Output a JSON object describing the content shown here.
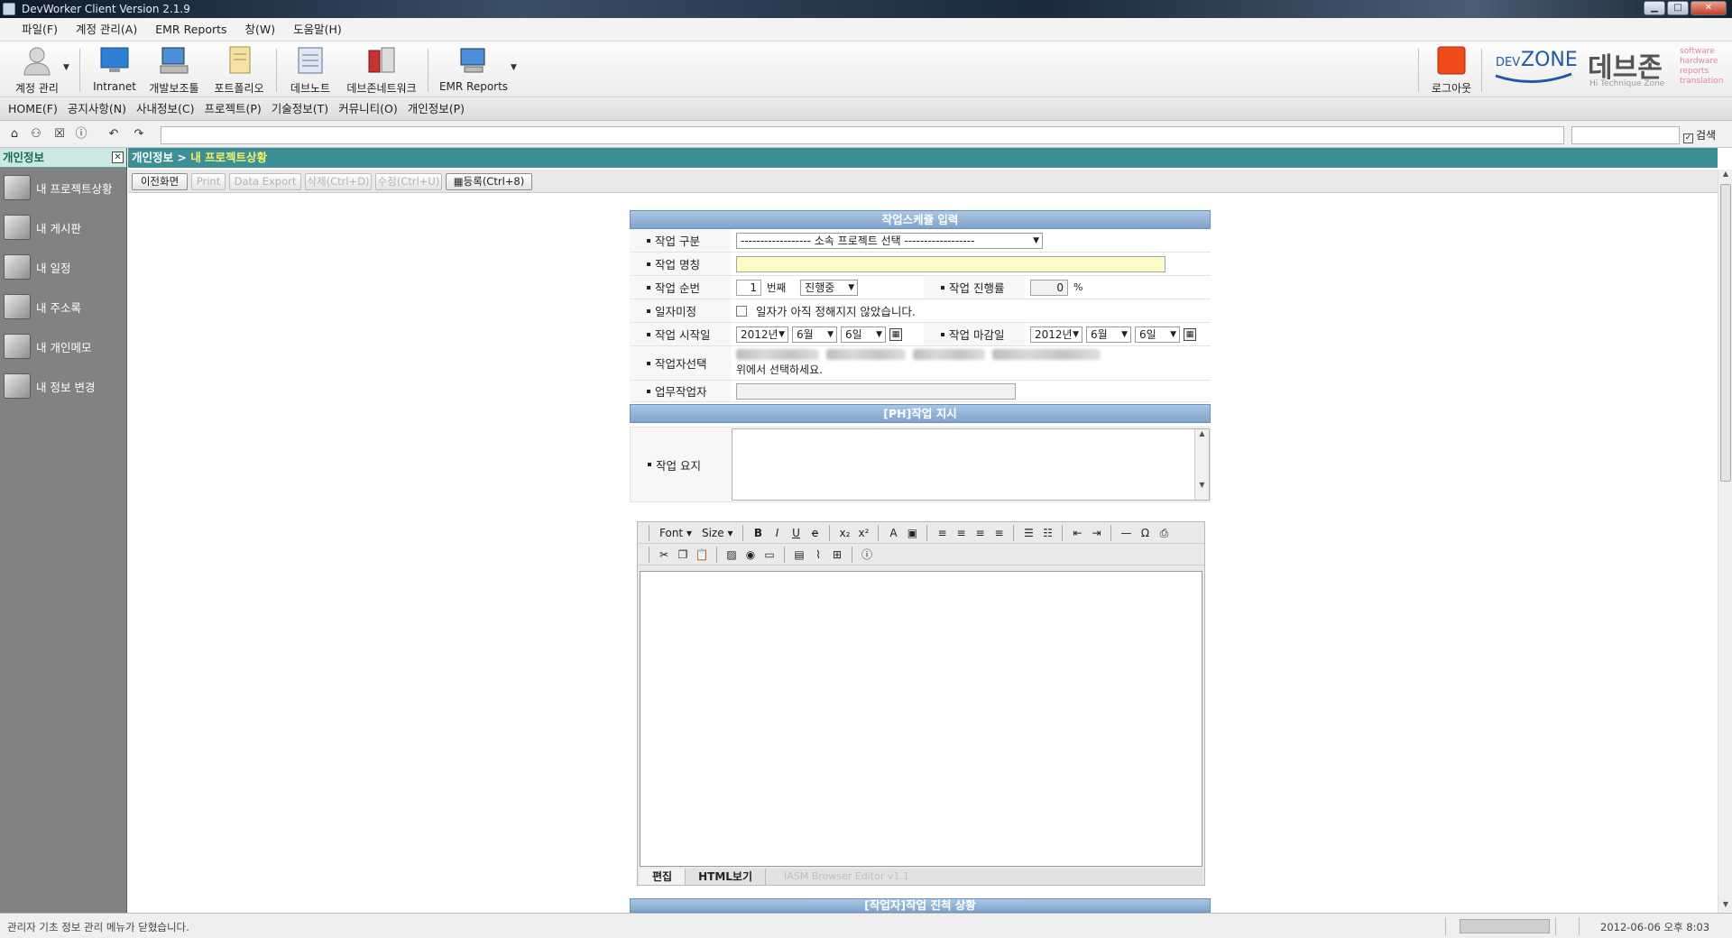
{
  "window": {
    "title": "DevWorker Client Version 2.1.9",
    "min": "▁",
    "max": "□",
    "close": "✕"
  },
  "menu": [
    "파일(F)",
    "계정 관리(A)",
    "EMR Reports",
    "창(W)",
    "도움말(H)"
  ],
  "toolbar": [
    {
      "label": "계정 관리",
      "icon": "user-icon"
    },
    {
      "label": "Intranet",
      "icon": "monitor-icon"
    },
    {
      "label": "개발보조툴",
      "icon": "computer-icon"
    },
    {
      "label": "포트폴리오",
      "icon": "document-icon"
    },
    {
      "label": "데브노트",
      "icon": "notebook-icon"
    },
    {
      "label": "데브존네트워크",
      "icon": "network-icon"
    },
    {
      "label": "EMR Reports",
      "icon": "report-icon"
    },
    {
      "label": "로그아웃",
      "icon": "logout-icon"
    }
  ],
  "logo": {
    "dev": "DEV",
    "zone": "ZONE",
    "korean": "데브존",
    "sub": "Hi Technique Zone",
    "tags": [
      "software",
      "hardware",
      "reports",
      "translation"
    ]
  },
  "nav": [
    "HOME(F)",
    "공지사항(N)",
    "사내정보(C)",
    "프로젝트(P)",
    "기술정보(T)",
    "커뮤니티(O)",
    "개인정보(P)"
  ],
  "search": {
    "label": "검색",
    "checked": "✓"
  },
  "sidebar": {
    "title": "개인정보",
    "items": [
      "내 프로젝트상황",
      "내 게시판",
      "내 일정",
      "내 주소록",
      "내 개인메모",
      "내 정보 변경"
    ]
  },
  "breadcrumb": {
    "parent": "개인정보",
    "sep": " > ",
    "current": "내 프로젝트상황"
  },
  "actions": [
    {
      "label": "이전화면",
      "enabled": true
    },
    {
      "label": "Print",
      "enabled": false
    },
    {
      "label": "Data Export",
      "enabled": false
    },
    {
      "label": "삭제(Ctrl+D)",
      "enabled": false
    },
    {
      "label": "수정(Ctrl+U)",
      "enabled": false
    },
    {
      "label": "등록(Ctrl+8)",
      "enabled": true
    }
  ],
  "form": {
    "section1": "작업스케쥴 입력",
    "labels": {
      "type": "작업 구분",
      "name": "작업 명칭",
      "order": "작업 순번",
      "progress": "작업 진행률",
      "undecided": "일자미정",
      "start": "작업 시작일",
      "end": "작업 마감일",
      "worker": "작업자선택",
      "task_worker": "업무작업자",
      "summary": "작업 요지"
    },
    "type_value": "------------------ 소속 프로젝트 선택 ------------------",
    "order_value": "1",
    "order_unit": "번째",
    "status_value": "진행중",
    "progress_value": "0",
    "progress_unit": "%",
    "undecided_text": "일자가 아직 정해지지 않았습니다.",
    "start": {
      "year": "2012년",
      "month": "6월",
      "day": "6일"
    },
    "end": {
      "year": "2012년",
      "month": "6월",
      "day": "6일"
    },
    "worker_hint": "위에서 선택하세요.",
    "section2": "[PH]작업 지시",
    "section3": "[작업자]작업 진척 상황"
  },
  "editor": {
    "font": "Font",
    "size": "Size",
    "tab_edit": "편집",
    "tab_html": "HTML보기",
    "version": "IASM Browser Editor v1.1"
  },
  "status": {
    "text": "관리자 기초 정보 관리 메뉴가 닫혔습니다.",
    "time": "2012-06-06 오후 8:03"
  }
}
